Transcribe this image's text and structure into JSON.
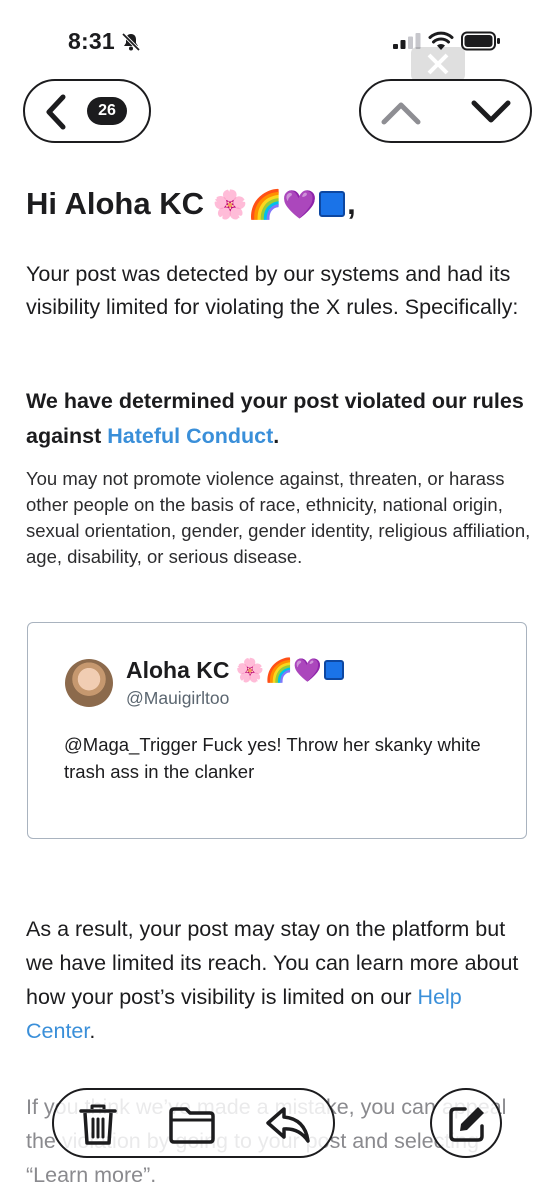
{
  "status_bar": {
    "time": "8:31"
  },
  "nav": {
    "unread_count": "26"
  },
  "email": {
    "greeting_prefix": "Hi Aloha KC ",
    "greeting_emojis": "🌸🌈💜",
    "greeting_suffix": ",",
    "p1": "Your post was detected by our systems and had its visibility limited for violating the X rules. Specifically:",
    "p2_before": "We have determined your post violated our rules against ",
    "p2_link": "Hateful Conduct",
    "p2_after": ".",
    "p3": "You may not promote violence against, threaten, or harass other people on the basis of race, ethnicity, national origin, sexual orientation, gender, gender identity, religious affiliation, age, disability, or serious disease.",
    "tweet": {
      "name": "Aloha KC ",
      "name_emojis": "🌸🌈💜",
      "handle": "@Mauigirltoo",
      "text": "@Maga_Trigger Fuck yes! Throw her skanky white trash ass in the clanker"
    },
    "p4_before": "As a result, your post may stay on the platform but we have limited its reach. You can learn more about how your post’s visibility is limited on our ",
    "p4_link": "Help Center",
    "p4_after": ".",
    "p5": "If you think we’ve made a mistake, you can appeal the violation by going to your post and selecting “Learn more”."
  },
  "colors": {
    "link": "#3a8fd9",
    "square_emoji": "#1a73e8"
  },
  "icons": [
    "bell-slash-icon",
    "signal-icon",
    "wifi-icon",
    "battery-icon",
    "chevron-left-icon",
    "chevron-up-icon",
    "chevron-down-icon",
    "trash-icon",
    "folder-icon",
    "reply-icon",
    "compose-icon"
  ]
}
